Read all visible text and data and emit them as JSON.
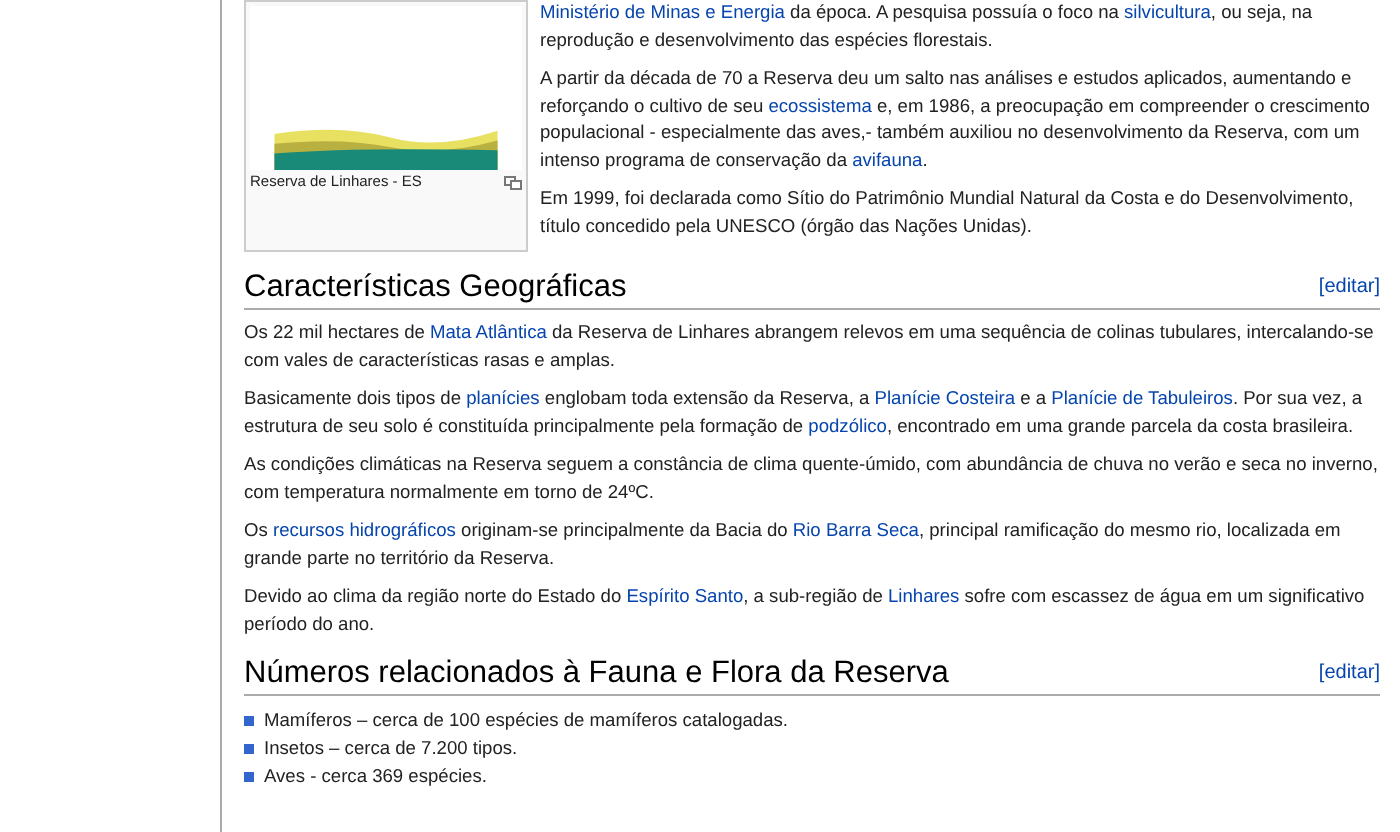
{
  "figure": {
    "caption": "Reserva de Linhares - ES"
  },
  "intro": [
    [
      {
        "t": "Ministério de Minas e Energia",
        "link": true
      },
      {
        "t": " da época. A pesquisa possuía o foco na ",
        "link": false
      },
      {
        "t": "silvicultura",
        "link": true
      },
      {
        "t": ", ou seja, na reprodução e desenvolvimento das espécies florestais.",
        "link": false
      }
    ],
    [
      {
        "t": "A partir da década de 70 a Reserva deu um salto nas análises e estudos aplicados, aumentando e reforçando o cultivo de seu ",
        "link": false
      },
      {
        "t": "ecossistema",
        "link": true
      },
      {
        "t": " e, em 1986, a preocupação em compreender o crescimento populacional - especialmente das aves,- também auxiliou no desenvolvimento da Reserva, com um intenso programa de conservação da ",
        "link": false
      },
      {
        "t": "avifauna",
        "link": true
      },
      {
        "t": ".",
        "link": false
      }
    ],
    [
      {
        "t": "Em 1999, foi declarada como Sítio do Patrimônio Mundial Natural da Costa e do Desenvolvimento, título concedido pela UNESCO (órgão das Nações Unidas).",
        "link": false
      }
    ]
  ],
  "sections": [
    {
      "heading": "Características Geográficas",
      "edit": "[editar]",
      "paragraphs": [
        [
          {
            "t": "Os 22 mil hectares de ",
            "link": false
          },
          {
            "t": "Mata Atlântica",
            "link": true
          },
          {
            "t": " da Reserva de Linhares abrangem relevos em uma sequência de colinas tubulares, intercalando-se com vales de características rasas e amplas.",
            "link": false
          }
        ],
        [
          {
            "t": "Basicamente dois tipos de ",
            "link": false
          },
          {
            "t": "planícies",
            "link": true
          },
          {
            "t": " englobam toda extensão da Reserva, a ",
            "link": false
          },
          {
            "t": "Planície Costeira",
            "link": true
          },
          {
            "t": " e a ",
            "link": false
          },
          {
            "t": "Planície de Tabuleiros",
            "link": true
          },
          {
            "t": ". Por sua vez, a estrutura de seu solo é constituída principalmente pela formação de ",
            "link": false
          },
          {
            "t": "podzólico",
            "link": true
          },
          {
            "t": ", encontrado em uma grande parcela da costa brasileira.",
            "link": false
          }
        ],
        [
          {
            "t": "As condições climáticas na Reserva seguem a constância de clima quente-úmido, com abundância de chuva no verão e seca no inverno, com temperatura normalmente em torno de 24ºC.",
            "link": false
          }
        ],
        [
          {
            "t": "Os ",
            "link": false
          },
          {
            "t": "recursos hidrográficos",
            "link": true
          },
          {
            "t": " originam-se principalmente da Bacia do ",
            "link": false
          },
          {
            "t": "Rio Barra Seca",
            "link": true
          },
          {
            "t": ", principal ramificação do mesmo rio, localizada em grande parte no território da Reserva.",
            "link": false
          }
        ],
        [
          {
            "t": "Devido ao clima da região norte do Estado do ",
            "link": false
          },
          {
            "t": "Espírito Santo",
            "link": true
          },
          {
            "t": ", a sub-região de ",
            "link": false
          },
          {
            "t": "Linhares",
            "link": true
          },
          {
            "t": " sofre com escassez de água em um significativo período do ano.",
            "link": false
          }
        ]
      ]
    },
    {
      "heading": "Números relacionados à Fauna e Flora da Reserva",
      "edit": "[editar]",
      "bullets": [
        "Mamíferos – cerca de 100 espécies de mamíferos catalogadas.",
        "Insetos – cerca de 7.200 tipos.",
        "Aves -  cerca 369 espécies."
      ]
    }
  ]
}
